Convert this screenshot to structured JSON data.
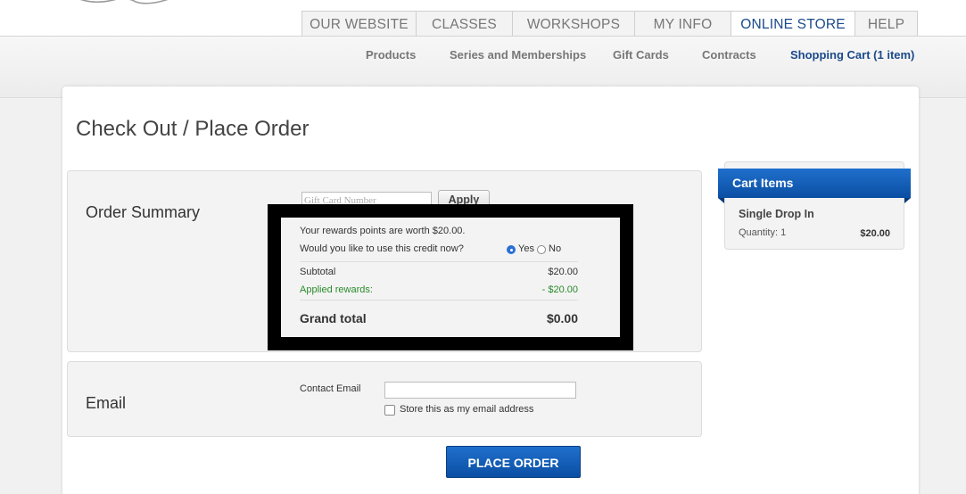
{
  "nav": {
    "tabs": [
      {
        "label": "OUR WEBSITE"
      },
      {
        "label": "CLASSES"
      },
      {
        "label": "WORKSHOPS"
      },
      {
        "label": "MY INFO"
      },
      {
        "label": "ONLINE STORE",
        "active": true
      },
      {
        "label": "HELP"
      }
    ],
    "subnav": [
      {
        "label": "Products"
      },
      {
        "label": "Series and Memberships"
      },
      {
        "label": "Gift Cards"
      },
      {
        "label": "Contracts"
      },
      {
        "label": "Shopping Cart (1 item)",
        "active": true
      }
    ]
  },
  "page": {
    "title": "Check Out / Place Order"
  },
  "order_summary": {
    "label": "Order Summary",
    "gift_card_placeholder": "Gift Card Number",
    "apply_label": "Apply",
    "rewards_text": "Your rewards points are worth $20.00.",
    "use_credit_question": "Would you like to use this credit now?",
    "yes_label": "Yes",
    "no_label": "No",
    "selected_option": "Yes",
    "subtotal_label": "Subtotal",
    "subtotal_value": "$20.00",
    "applied_rewards_label": "Applied rewards:",
    "applied_rewards_value": "- $20.00",
    "grand_total_label": "Grand total",
    "grand_total_value": "$0.00"
  },
  "email": {
    "label": "Email",
    "contact_label": "Contact Email",
    "contact_value": "",
    "store_label": "Store this as my email address"
  },
  "place_order_label": "PLACE ORDER",
  "cart": {
    "title": "Cart Items",
    "items": [
      {
        "name": "Single Drop In",
        "quantity": "Quantity: 1",
        "price": "$20.00"
      }
    ]
  },
  "colors": {
    "accent": "#0b4fa3",
    "active_nav": "#1b4a8a",
    "applied_rewards": "#2a8b2a"
  }
}
